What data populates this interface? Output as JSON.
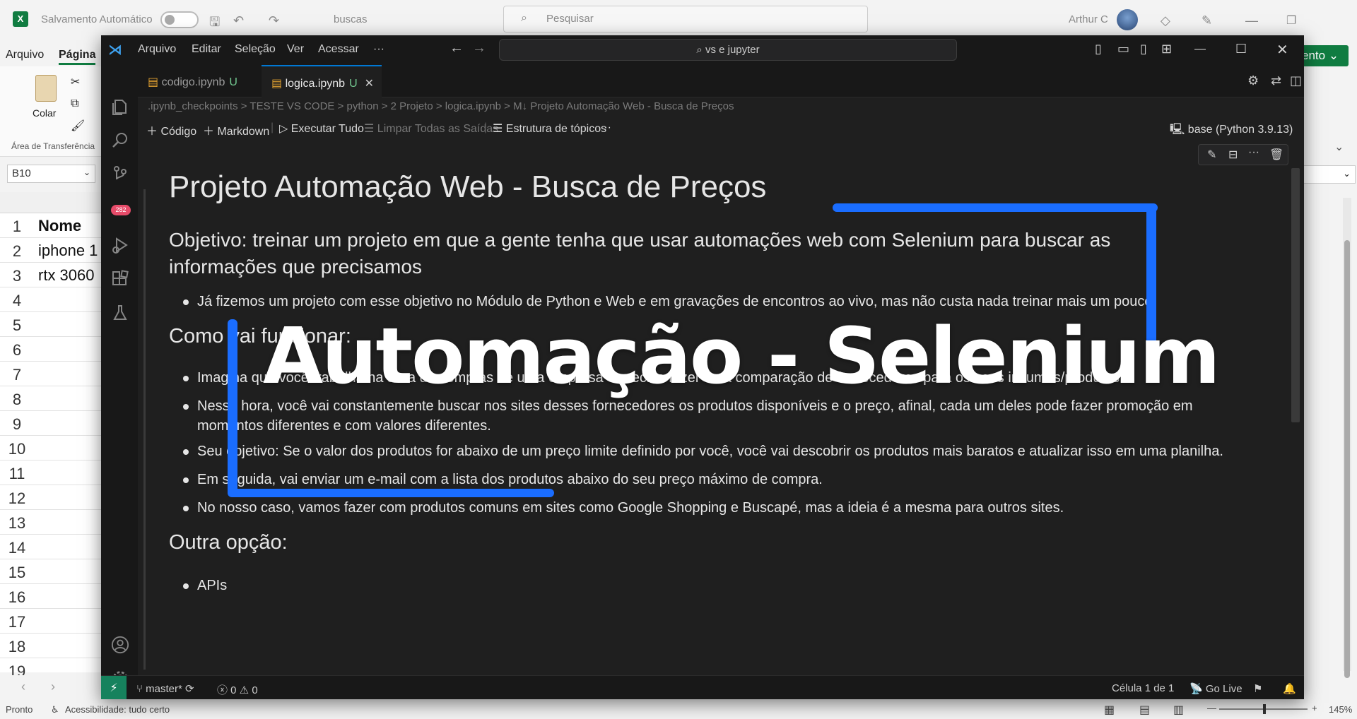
{
  "excel": {
    "autosave_label": "Salvamento Automático",
    "filename": "buscas",
    "search_placeholder": "Pesquisar",
    "user": "Arthur C",
    "menu": [
      "Arquivo",
      "Página"
    ],
    "ribbon": {
      "paste": "Colar",
      "group": "Área de Transferência"
    },
    "namebox": "B10",
    "rows": [
      {
        "num": "1",
        "value": "Nome"
      },
      {
        "num": "2",
        "value": "iphone 1"
      },
      {
        "num": "3",
        "value": "rtx 3060"
      },
      {
        "num": "4",
        "value": ""
      },
      {
        "num": "5",
        "value": ""
      },
      {
        "num": "6",
        "value": ""
      },
      {
        "num": "7",
        "value": ""
      },
      {
        "num": "8",
        "value": ""
      },
      {
        "num": "9",
        "value": ""
      },
      {
        "num": "10",
        "value": ""
      },
      {
        "num": "11",
        "value": ""
      },
      {
        "num": "12",
        "value": ""
      },
      {
        "num": "13",
        "value": ""
      },
      {
        "num": "14",
        "value": ""
      },
      {
        "num": "15",
        "value": ""
      },
      {
        "num": "16",
        "value": ""
      },
      {
        "num": "17",
        "value": ""
      },
      {
        "num": "18",
        "value": ""
      },
      {
        "num": "19",
        "value": ""
      }
    ],
    "right_button": "ento",
    "status_ready": "Pronto",
    "status_accessibility": "Acessibilidade: tudo certo",
    "zoom": "145%"
  },
  "vscode": {
    "menu": [
      "Arquivo",
      "Editar",
      "Seleção",
      "Ver",
      "Acessar",
      "···"
    ],
    "command_center": "vs e jupyter",
    "tabs": [
      {
        "label": "codigo.ipynb",
        "badge": "U",
        "active": false
      },
      {
        "label": "logica.ipynb",
        "badge": "U",
        "active": true
      }
    ],
    "breadcrumb": ".ipynb_checkpoints  >  TESTE VS CODE  >  python  >  2 Projeto  >  logica.ipynb  >  M↓ Projeto Automação Web - Busca de Preços",
    "toolbar": {
      "code": "Código",
      "markdown": "Markdown",
      "run_all": "Executar Tudo",
      "clear_outputs": "Limpar Todas as Saídas",
      "outline": "Estrutura de tópicos",
      "more": "···",
      "kernel": "base (Python 3.9.13)"
    },
    "notebook": {
      "title": "Projeto Automação Web - Busca de Preços",
      "objective_line1": "Objetivo: treinar um projeto em que a gente tenha que usar automações web com Selenium para buscar as",
      "objective_line2": "informações que precisamos",
      "bullet1": "Já fizemos um projeto com esse objetivo no Módulo de Python e Web e em gravações de encontros ao vivo, mas não custa nada treinar mais um pouco.",
      "h2_how": "Como vai funcionar:",
      "bullet2": "Imagina que você trabalha na área de compras de uma empresa e precisa fazer uma comparação de fornecedores para os seus insumos/produtos.",
      "bullet3_line1": "Nessa hora, você vai constantemente buscar nos sites desses fornecedores os produtos disponíveis e o preço, afinal, cada um deles pode fazer promoção em",
      "bullet3_line2": "momentos diferentes e com valores diferentes.",
      "bullet4": "Seu objetivo: Se o valor dos produtos for abaixo de um preço limite definido por você, você vai descobrir os produtos mais baratos e atualizar isso em uma planilha.",
      "bullet5": "Em seguida, vai enviar um e-mail com a lista dos produtos abaixo do seu preço máximo de compra.",
      "bullet6": "No nosso caso, vamos fazer com produtos comuns em sites como Google Shopping e Buscapé, mas a ideia é a mesma para outros sites.",
      "h2_other": "Outra opção:",
      "bullet7": "APIs"
    },
    "status": {
      "branch": "master*",
      "errors": "0",
      "warnings": "0",
      "cell": "Célula 1 de 1",
      "golive": "Go Live",
      "badge_count": "282"
    }
  },
  "overlay": {
    "title": "Automação - Selenium",
    "accent_color": "#1a6dff"
  },
  "colors": {
    "excel_green": "#107c41",
    "vscode_blue": "#0078d4"
  }
}
